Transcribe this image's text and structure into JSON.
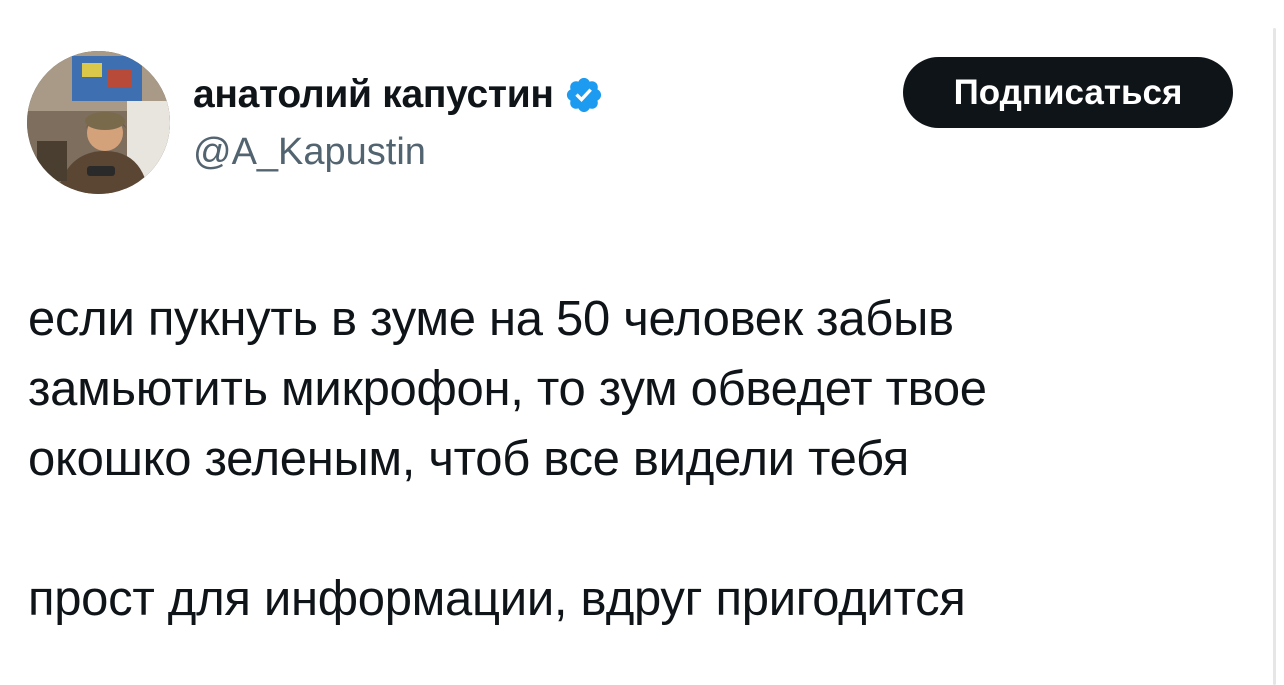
{
  "author": {
    "display_name": "анатолий капустин",
    "handle": "@A_Kapustin",
    "verified_icon": "verified-badge-icon",
    "badge_color": "#1d9bf0"
  },
  "actions": {
    "follow_label": "Подписаться"
  },
  "tweet": {
    "lines": [
      "если пукнуть в зуме на 50 человек забыв",
      "замьютить микрофон, то зум обведет твое",
      "окошко зеленым, чтоб все видели тебя"
    ],
    "paragraph2": "прост для информации, вдруг пригодится"
  },
  "colors": {
    "text": "#0f1419",
    "secondary": "#536471",
    "button_bg": "#0f1419",
    "button_text": "#ffffff"
  }
}
